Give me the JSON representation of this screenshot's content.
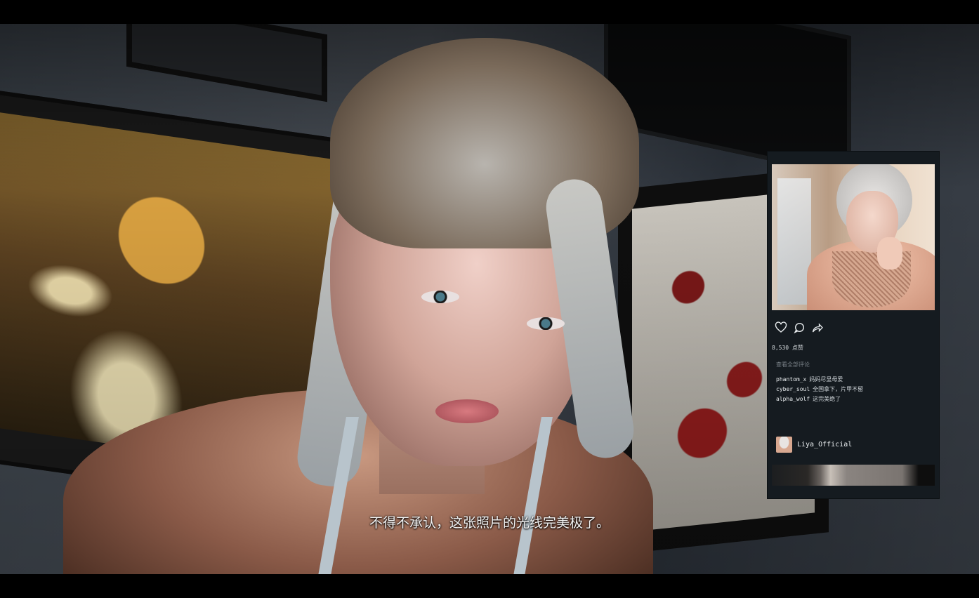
{
  "dialogue": {
    "subtitle": "不得不承认，这张照片的光线完美极了。"
  },
  "social_post": {
    "likes_text": "8,530 点赞",
    "view_all_comments": "查看全部评论",
    "comments": [
      {
        "user": "phantom_x",
        "text": "妈妈尽显母爱"
      },
      {
        "user": "cyber_soul",
        "text": "全国拿下，片甲不留"
      },
      {
        "user": "alpha_wolf",
        "text": "这完美绝了"
      }
    ],
    "actions": [
      {
        "name": "like",
        "icon": "heart-icon"
      },
      {
        "name": "comment",
        "icon": "speech-bubble-icon"
      },
      {
        "name": "share",
        "icon": "share-arrow-icon"
      }
    ],
    "next_post": {
      "username": "Liya_Official"
    }
  },
  "colors": {
    "panel_bg": "#151b20",
    "subtitle_text": "#f2f2f2",
    "comment_text": "#d0d6da",
    "muted_text": "#7a8288"
  }
}
